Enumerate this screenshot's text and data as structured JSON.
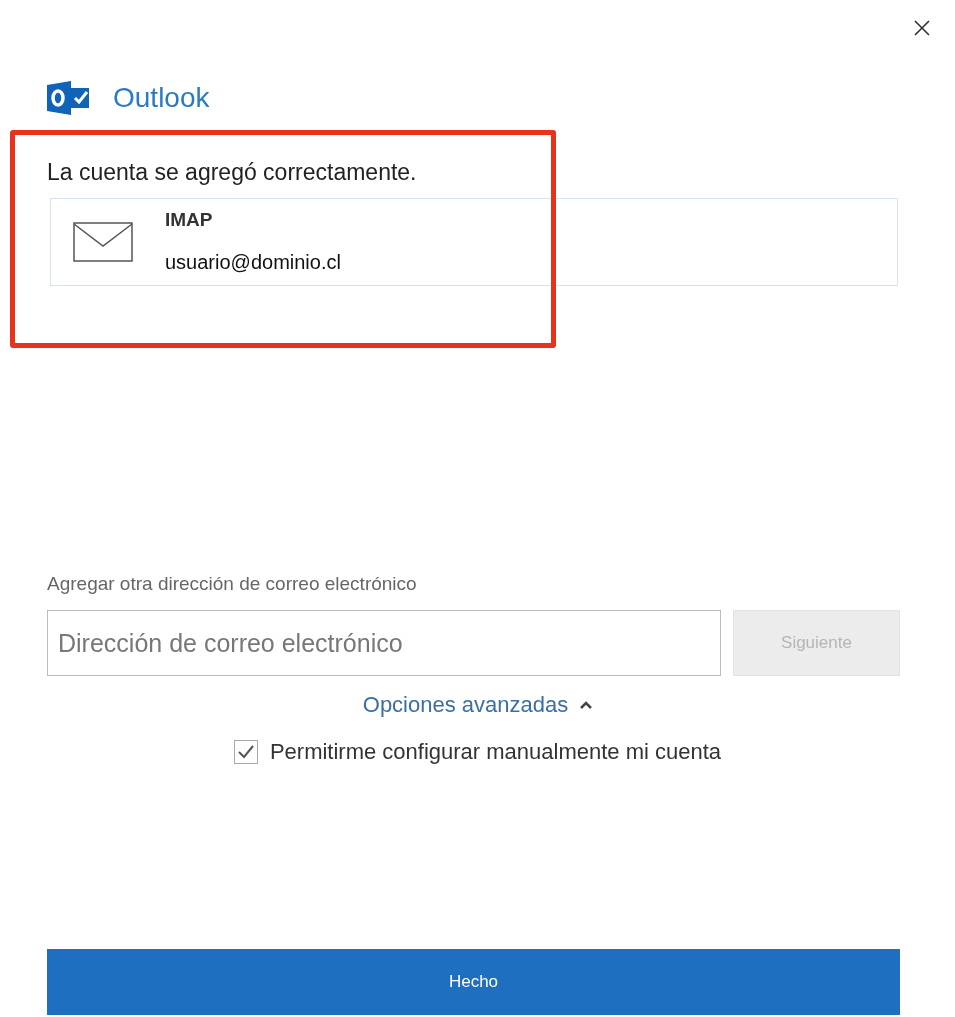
{
  "app": {
    "name": "Outlook"
  },
  "status": {
    "message": "La cuenta se agregó correctamente."
  },
  "account": {
    "type": "IMAP",
    "email": "usuario@dominio.cl"
  },
  "add_account": {
    "label": "Agregar otra dirección de correo electrónico",
    "placeholder": "Dirección de correo electrónico",
    "next_button": {
      "label": "Siguiente",
      "disabled": true
    }
  },
  "advanced": {
    "label": "Opciones avanzadas",
    "expanded": true
  },
  "manual_setup": {
    "label": "Permitirme configurar manualmente mi cuenta",
    "checked": true
  },
  "done_button": {
    "label": "Hecho"
  },
  "highlight": {
    "on": true
  }
}
